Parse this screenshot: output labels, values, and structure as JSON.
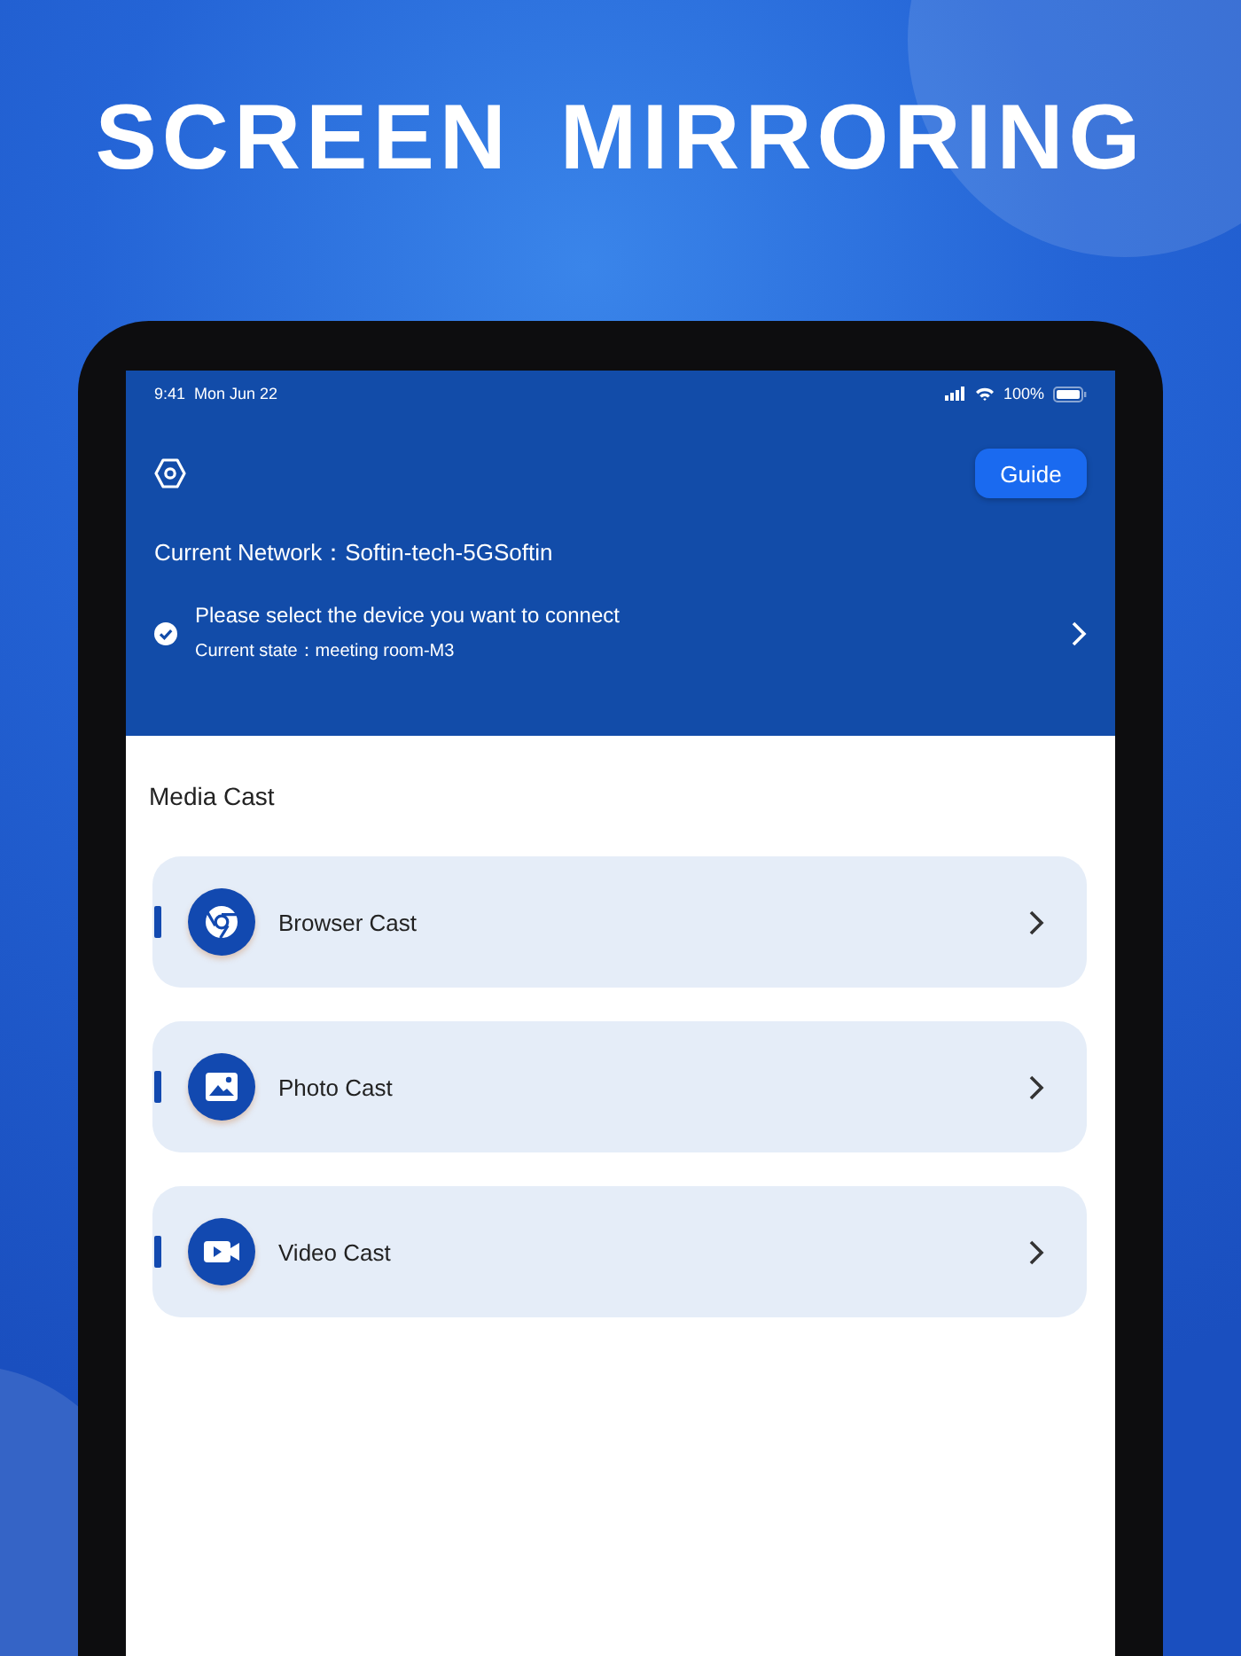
{
  "headline": "SCREEN MIRRORING",
  "status_bar": {
    "time": "9:41",
    "date": "Mon Jun 22",
    "battery": "100%"
  },
  "header": {
    "guide_button": "Guide",
    "network": "Current Network：Softin-tech-5GSoftin",
    "device_prompt": "Please select the device you want to connect",
    "current_state": "Current state：meeting room-M3"
  },
  "section_title": "Media Cast",
  "cast_items": [
    {
      "kind": "browser",
      "label": "Browser Cast"
    },
    {
      "kind": "photo",
      "label": "Photo Cast"
    },
    {
      "kind": "video",
      "label": "Video Cast"
    }
  ]
}
